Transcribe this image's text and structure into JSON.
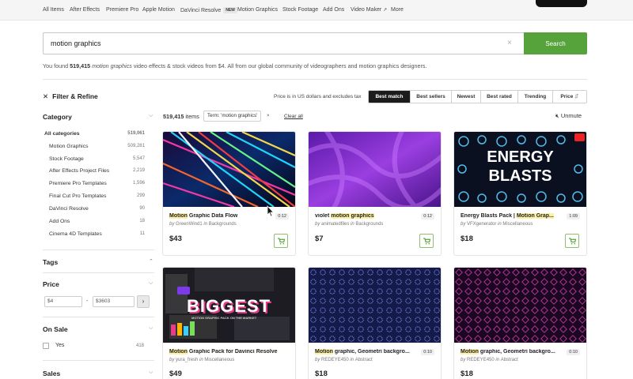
{
  "topnav": {
    "items": [
      "All Items",
      "After Effects",
      "Premiere Pro",
      "Apple Motion",
      "DaVinci Resolve",
      "Motion Graphics",
      "Stock Footage",
      "Add Ons",
      "Video Maker",
      "More"
    ],
    "new_badge": "NEW",
    "external_icon": "external-link-icon"
  },
  "search": {
    "value": "motion graphics",
    "clear_icon": "close-icon",
    "button_label": "Search",
    "accent_color": "#57a33b"
  },
  "results_summary": {
    "prefix": "You found ",
    "count": "519,415",
    "term": "motion graphics",
    "suffix": " video effects & stock videos from $4. All from our global community of videographers and motion graphics designers."
  },
  "filter": {
    "title": "Filter & Refine",
    "close_icon": "close-icon"
  },
  "sort": {
    "price_note": "Price is in US dollars and excludes tax",
    "options": [
      "Best match",
      "Best sellers",
      "Newest",
      "Best rated",
      "Trending",
      "Price"
    ],
    "active": "Best match"
  },
  "sidebar": {
    "category": {
      "title": "Category",
      "items": [
        {
          "label": "All categories",
          "count": "519,061"
        },
        {
          "label": "Motion Graphics",
          "count": "509,281"
        },
        {
          "label": "Stock Footage",
          "count": "5,547"
        },
        {
          "label": "After Effects Project Files",
          "count": "2,219"
        },
        {
          "label": "Premiere Pro Templates",
          "count": "1,596"
        },
        {
          "label": "Final Cut Pro Templates",
          "count": "299"
        },
        {
          "label": "DaVinci Resolve",
          "count": "90"
        },
        {
          "label": "Add Ons",
          "count": "18"
        },
        {
          "label": "Cinema 4D Templates",
          "count": "11"
        }
      ]
    },
    "tags": {
      "title": "Tags"
    },
    "price": {
      "title": "Price",
      "min": "$4",
      "max": "$3603",
      "separator": "-",
      "go_icon": "chevron-right-icon"
    },
    "on_sale": {
      "title": "On Sale",
      "option_label": "Yes",
      "option_count": "418"
    },
    "sales": {
      "title": "Sales"
    }
  },
  "results_bar": {
    "count": "519,415",
    "count_label": " items",
    "term_chip": "Term: 'motion graphics'",
    "chip_close": "×",
    "clear_all": "Clear all",
    "unmute": "Unmute",
    "speaker_icon": "speaker-muted-icon"
  },
  "cards": [
    {
      "title_hl": "Motion",
      "title_rest": " Graphic Data Flow",
      "author_prefix": "by ",
      "author": "GreenWind1",
      "category_prefix": " in ",
      "category": "Backgrounds",
      "duration": "0:12",
      "price": "$43"
    },
    {
      "title_pre": "violet ",
      "title_hl": "motion graphics",
      "title_rest": "",
      "author_prefix": "by ",
      "author": "animatedfiles",
      "category_prefix": " in ",
      "category": "Backgrounds",
      "duration": "0:12",
      "price": "$7"
    },
    {
      "title_pre": "Energy Blasts Pack | ",
      "title_hl": "Motion Grap",
      "title_rest": "...",
      "author_prefix": "by ",
      "author": "VFXgenerator",
      "category_prefix": " in ",
      "category": "Miscellaneous",
      "duration": "1:09",
      "price": "$18",
      "thumb_text_1": "ENERGY",
      "thumb_text_2": "BLASTS"
    },
    {
      "title_hl": "Motion",
      "title_rest": " Graphic Pack for Davinci Resolve",
      "author_prefix": "by ",
      "author": "yura_fresh",
      "category_prefix": " in ",
      "category": "Miscellaneous",
      "duration": "",
      "price": "$49",
      "thumb_text_1": "BIGGEST",
      "thumb_text_2": "MOTION GRAPHIC PACK ON THE MARKET"
    },
    {
      "title_hl": "Motion",
      "title_rest": " graphic, Geometri backgro...",
      "author_prefix": "by ",
      "author": "REDEYE450",
      "category_prefix": " in ",
      "category": "Abstract",
      "duration": "0:10",
      "price": "$18"
    },
    {
      "title_hl": "Motion",
      "title_rest": " graphic, Geometri backgro...",
      "author_prefix": "by ",
      "author": "REDEYE450",
      "category_prefix": " in ",
      "category": "Abstract",
      "duration": "0:10",
      "price": "$18"
    }
  ],
  "icons": {
    "cart": "cart-icon",
    "cursor": "mouse-cursor-icon",
    "chevron_down": "chevron-down-icon",
    "chevron_up": "chevron-up-icon"
  }
}
